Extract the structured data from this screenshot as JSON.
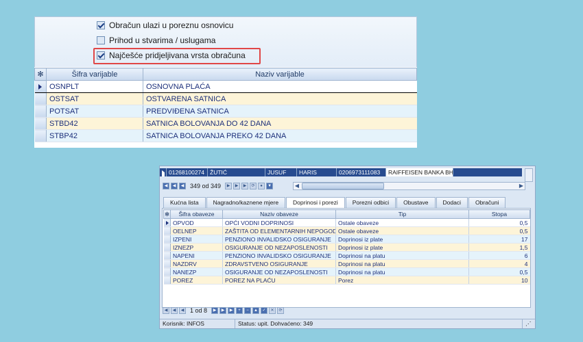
{
  "options": {
    "checkboxes": [
      {
        "label": "Obračun ulazi u poreznu osnovicu",
        "checked": true
      },
      {
        "label": "Prihod u stvarima / uslugama",
        "checked": false
      },
      {
        "label": "Najčešće pridjeljivana vrsta obračuna",
        "checked": true
      }
    ],
    "highlight_color": "#e04646"
  },
  "variables_grid": {
    "columns": [
      "Šifra varijable",
      "Naziv varijable"
    ],
    "rows": [
      {
        "code": "OSNPLT",
        "name": "OSNOVNA PLAĆA"
      },
      {
        "code": "OSTSAT",
        "name": "OSTVARENA SATNICA"
      },
      {
        "code": "POTSAT",
        "name": "PREDVIĐENA SATNICA"
      },
      {
        "code": "STBD42",
        "name": "SATNICA BOLOVANJA DO 42 DANA"
      },
      {
        "code": "STBP42",
        "name": "SATNICA BOLOVANJA PREKO 42 DANA"
      }
    ]
  },
  "employee_row": {
    "id": "01268100274",
    "surname": "ŽUTIĆ",
    "name": "JUSUF",
    "parent": "HARIS",
    "account": "0206973111083",
    "bank": "RAIFFEISEN BANKA BH"
  },
  "record_nav": {
    "text": "349 od 349"
  },
  "tabs": [
    "Kućna lista",
    "Nagradno/kaznene mjere",
    "Doprinosi i porezi",
    "Porezni odbici",
    "Obustave",
    "Dodaci",
    "Obračuni"
  ],
  "active_tab": "Doprinosi i porezi",
  "obligations_grid": {
    "columns": [
      "Šifra obaveze",
      "Naziv obaveze",
      "Tip",
      "Stopa"
    ],
    "rows": [
      {
        "code": "OPVOD",
        "name": "OPĆI VODNI DOPRINOSI",
        "type": "Ostale obaveze",
        "rate": "0,5"
      },
      {
        "code": "OELNEP",
        "name": "ZAŠTITA OD ELEMENTARNIH NEPOGODA",
        "type": "Ostale obaveze",
        "rate": "0,5"
      },
      {
        "code": "IZPENI",
        "name": "PENZIONO INVALIDSKO OSIGURANJE",
        "type": "Doprinosi iz plate",
        "rate": "17"
      },
      {
        "code": "IZNEZP",
        "name": "OSIGURANJE OD NEZAPOSLENOSTI",
        "type": "Doprinosi iz plate",
        "rate": "1,5"
      },
      {
        "code": "NAPENI",
        "name": "PENZIONO INVALIDSKO OSIGURANJE",
        "type": "Doprinosi na platu",
        "rate": "6"
      },
      {
        "code": "NAZDRV",
        "name": "ZDRAVSTVENO OSIGURANJE",
        "type": "Doprinosi na platu",
        "rate": "4"
      },
      {
        "code": "NANEZP",
        "name": "OSIGURANJE OD NEZAPOSLENOSTI",
        "type": "Doprinosi na platu",
        "rate": "0,5"
      },
      {
        "code": "POREZ",
        "name": "POREZ NA PLAĆU",
        "type": "Porez",
        "rate": "10"
      }
    ]
  },
  "inner_nav": {
    "text": "1 od 8"
  },
  "status": {
    "user": "Korisnik: INFOS",
    "status": "Status: upit. Dohvaćeno: 349"
  }
}
